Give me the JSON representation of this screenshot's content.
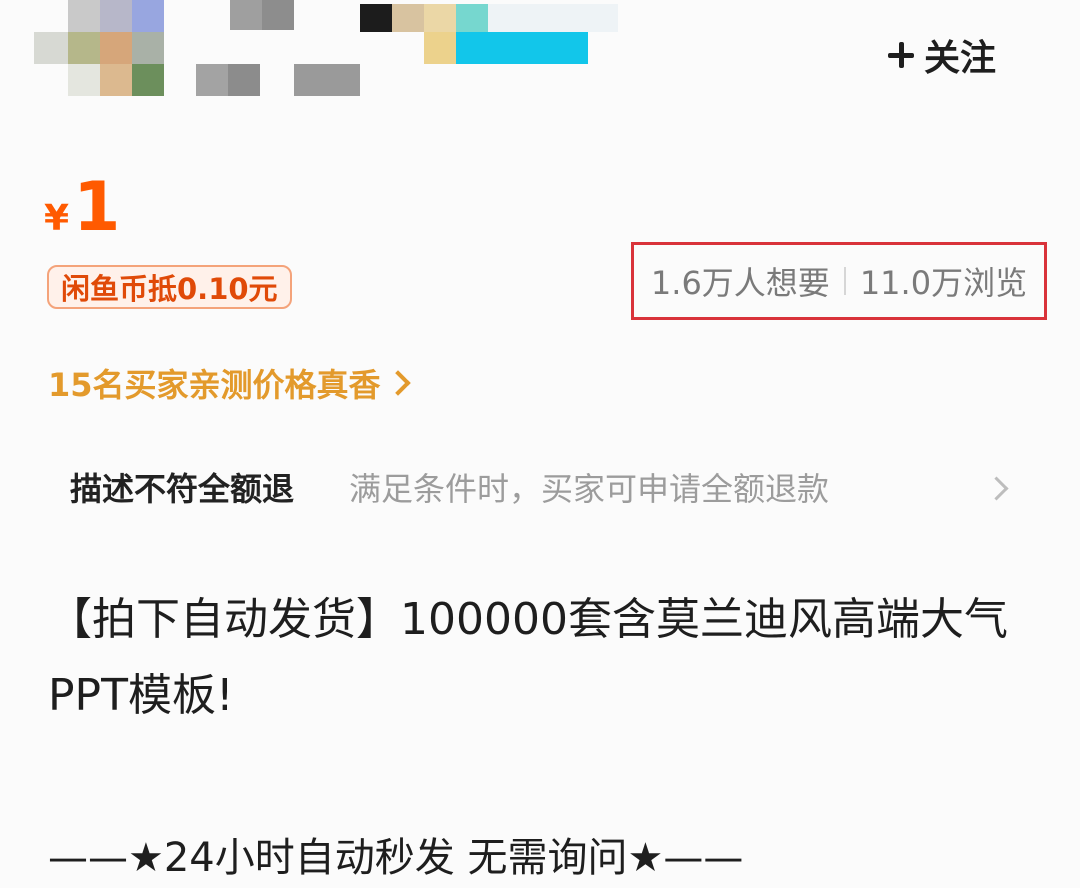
{
  "header": {
    "follow_label": "关注"
  },
  "price": {
    "currency": "¥",
    "value": "1",
    "coin_note": "闲鱼币抵0.10元"
  },
  "stats": {
    "wants": "1.6万人想要",
    "views": "11.0万浏览"
  },
  "buyers_link": "15名买家亲测价格真香",
  "guarantee": {
    "title": "描述不符全额退",
    "description": "满足条件时，买家可申请全额退款"
  },
  "description": {
    "title": "【拍下自动发货】100000套含莫兰迪风高端大气PPT模板!",
    "subtitle": "——★24小时自动秒发 无需询问★——"
  },
  "colors": {
    "price": "#ff5a00",
    "highlight_box": "#d9333a",
    "buyers_link": "#e39a2c"
  },
  "icons": [
    "plus-icon",
    "chevron-right-icon"
  ]
}
